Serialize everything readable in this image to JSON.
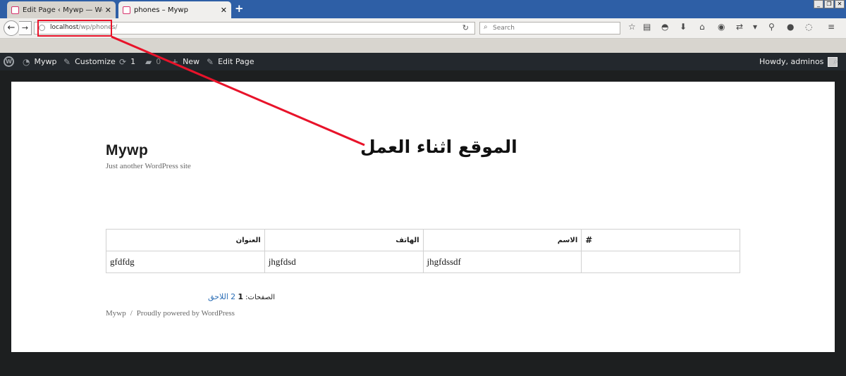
{
  "browser": {
    "tabs": [
      {
        "label": "Edit Page ‹ Mywp — WordPress",
        "active": false
      },
      {
        "label": "phones – Mywp",
        "active": true
      }
    ],
    "url": {
      "host": "localhost",
      "path": "/wp/phones/"
    },
    "search_placeholder": "Search",
    "window_controls": [
      "minimize",
      "restore",
      "close"
    ]
  },
  "admin_bar": {
    "site_name": "Mywp",
    "customize": "Customize",
    "updates_count": "1",
    "comments_count": "0",
    "new_label": "New",
    "edit_page": "Edit Page",
    "howdy": "Howdy, adminos"
  },
  "site": {
    "title": "Mywp",
    "description": "Just another WordPress site"
  },
  "annotation_text": "الموقع اثناء العمل",
  "table": {
    "headers": [
      "العنوان",
      "الهاتف",
      "الاسم",
      "#"
    ],
    "rows": [
      [
        "gfdfdg",
        "jhgfdsd",
        "jhgfdssdf",
        ""
      ]
    ]
  },
  "pagination": {
    "label": "الصفحات:",
    "current": "1",
    "next_page": "2",
    "next_label": "اللاحق"
  },
  "footer": {
    "site": "Mywp",
    "separator": "/",
    "powered": "Proudly powered by WordPress"
  },
  "colors": {
    "annotation_red": "#e8132a",
    "admin_bar": "#23282d",
    "link": "#2a6db5"
  }
}
